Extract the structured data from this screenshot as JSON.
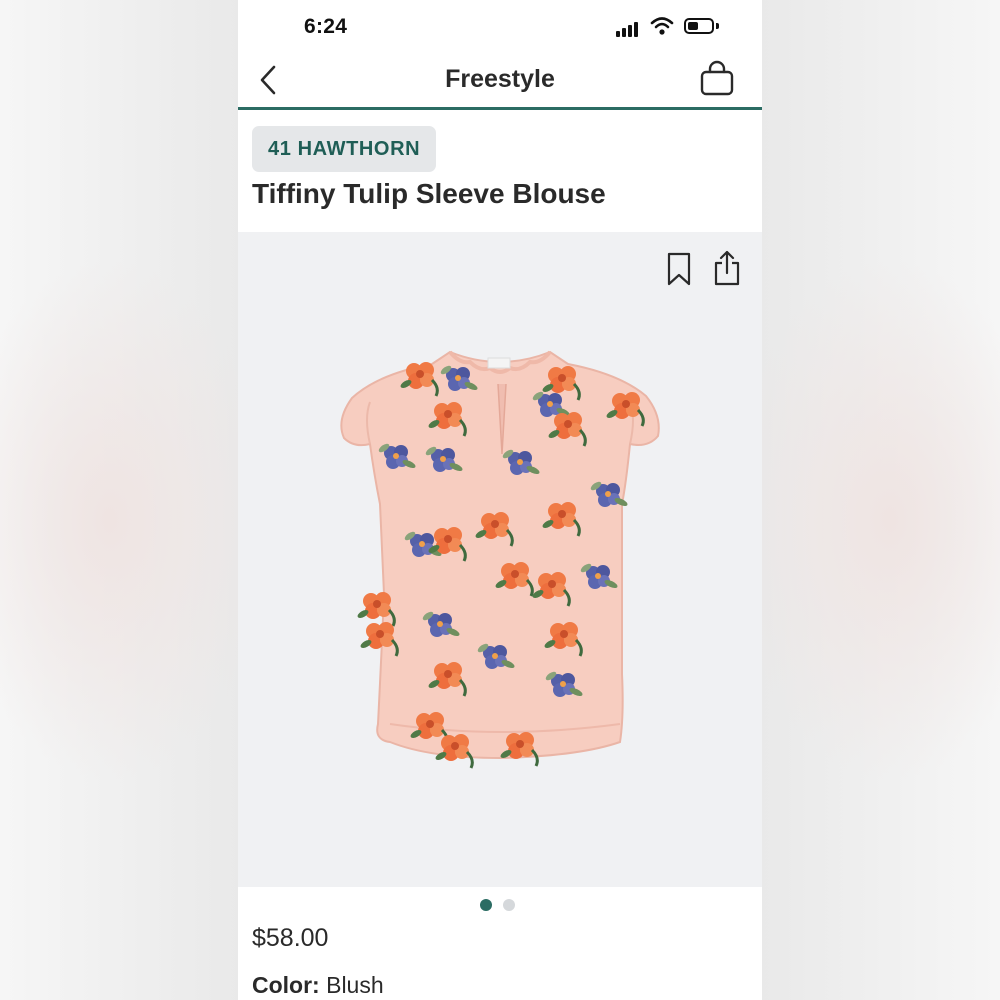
{
  "status_bar": {
    "time": "6:24",
    "battery_level": 0.45
  },
  "nav": {
    "title": "Freestyle",
    "back_icon": "chevron-left-icon",
    "bag_icon": "shopping-bag-icon"
  },
  "product": {
    "brand": "41 HAWTHORN",
    "name": "Tiffiny Tulip Sleeve Blouse",
    "price": "$58.00",
    "color_label": "Color:",
    "color_value": "Blush",
    "image_icons": [
      "bookmark-icon",
      "share-icon"
    ]
  },
  "carousel": {
    "total": 2,
    "active_index": 0
  },
  "colors": {
    "accent": "#2b6c63",
    "brand_text": "#1f5e56",
    "badge_bg": "#e5e7e9",
    "image_bg": "#f0f1f3",
    "blouse": "#f7cdc0"
  }
}
